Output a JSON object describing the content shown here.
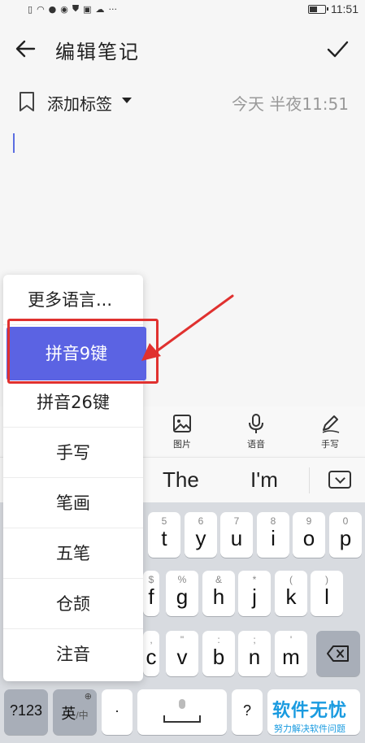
{
  "status_bar": {
    "time": "11:51",
    "left_icons": [
      "sim-icon",
      "wifi-icon",
      "wechat-icon",
      "app-icon",
      "shield-icon",
      "app-icon",
      "cloud-icon",
      "more-icon"
    ],
    "more": "···",
    "battery_level": 0.55
  },
  "header": {
    "title": "编辑笔记"
  },
  "note_meta": {
    "tag_label": "添加标签",
    "timestamp": "今天 半夜11:51"
  },
  "toolbar": {
    "image_label": "图片",
    "voice_label": "语音",
    "handwrite_label": "手写"
  },
  "candidates": {
    "items": [
      "The",
      "I'm"
    ]
  },
  "language_menu": {
    "items": [
      "更多语言...",
      "拼音9键",
      "拼音26键",
      "手写",
      "笔画",
      "五笔",
      "仓颉",
      "注音"
    ],
    "selected_index": 1
  },
  "keyboard": {
    "row1": [
      {
        "hint": "5",
        "key": "t"
      },
      {
        "hint": "6",
        "key": "y"
      },
      {
        "hint": "7",
        "key": "u"
      },
      {
        "hint": "8",
        "key": "i"
      },
      {
        "hint": "9",
        "key": "o"
      },
      {
        "hint": "0",
        "key": "p"
      }
    ],
    "row2": [
      {
        "hint": "$",
        "key": "f"
      },
      {
        "hint": "%",
        "key": "g"
      },
      {
        "hint": "&",
        "key": "h"
      },
      {
        "hint": "*",
        "key": "j"
      },
      {
        "hint": "(",
        "key": "k"
      },
      {
        "hint": ")",
        "key": "l"
      }
    ],
    "row3": [
      {
        "hint": ",",
        "key": "c"
      },
      {
        "hint": "\"",
        "key": "v"
      },
      {
        "hint": ":",
        "key": "b"
      },
      {
        "hint": ";",
        "key": "n"
      },
      {
        "hint": "'",
        "key": "m"
      }
    ],
    "num_key": "?123",
    "lang_key_main": "英",
    "lang_key_sub": "中",
    "dot_key": "·",
    "question_key": "?"
  },
  "watermark": {
    "main": "软件无忧",
    "sub": "努力解决软件问题"
  },
  "colors": {
    "accent": "#5b63e3",
    "annotation_red": "#e0312f",
    "watermark_blue": "#1a9be0"
  }
}
